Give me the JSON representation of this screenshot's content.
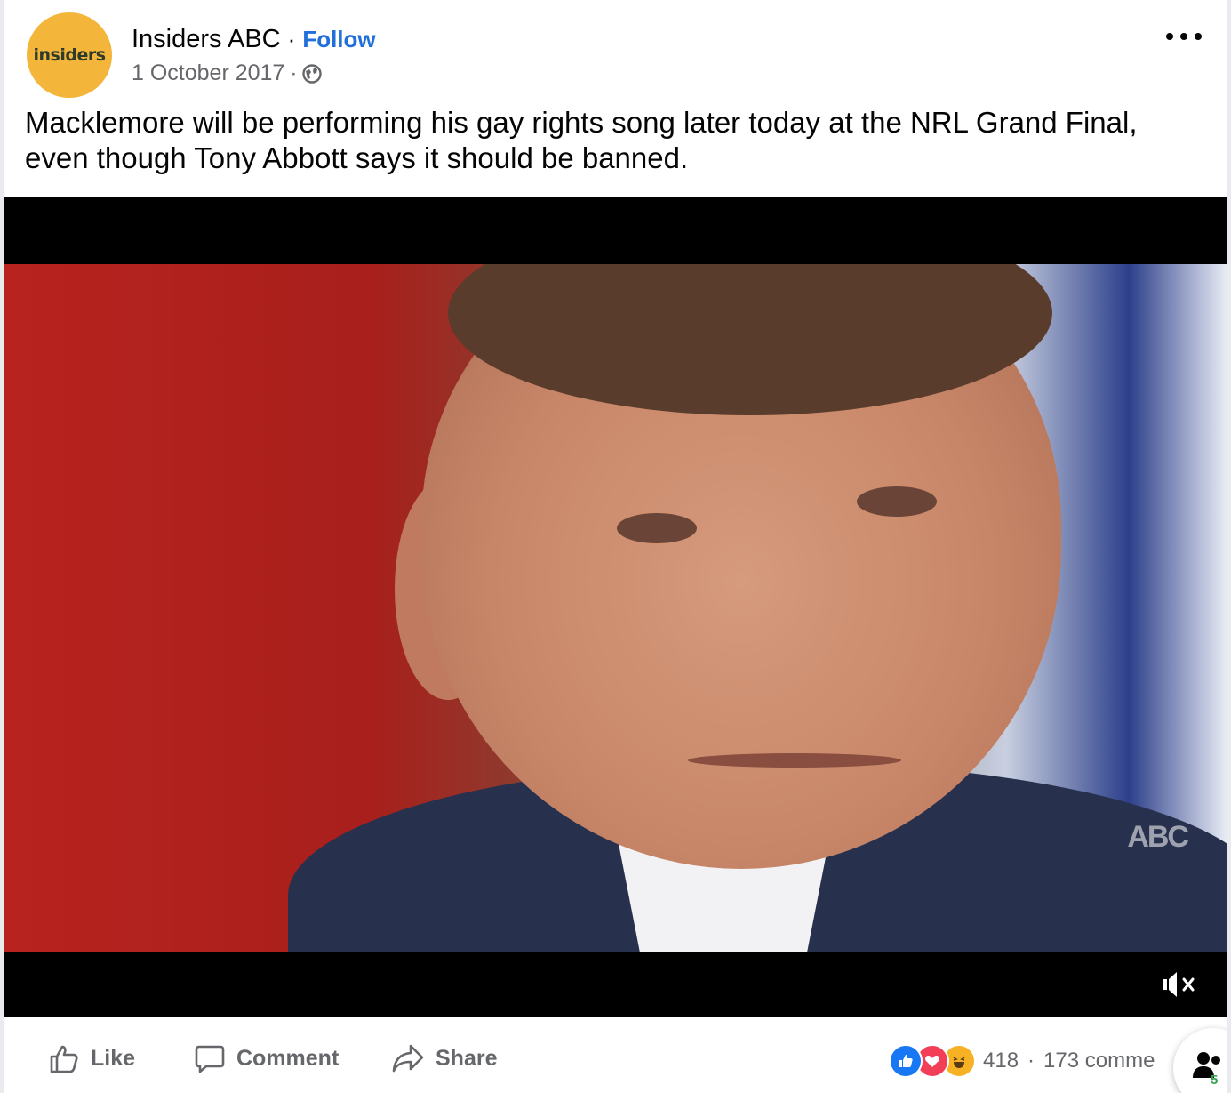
{
  "post": {
    "avatar_text": "insiders",
    "page_name": "Insiders ABC",
    "separator": "·",
    "follow_label": "Follow",
    "date": "1 October 2017",
    "date_separator": "·",
    "privacy_icon": "globe-icon",
    "text": "Macklemore will be performing his gay rights song later today at the NRL Grand Final, even though Tony Abbott says it should be banned."
  },
  "video": {
    "watermark": "ABC",
    "muted": true
  },
  "actions": {
    "like_label": "Like",
    "comment_label": "Comment",
    "share_label": "Share"
  },
  "stats": {
    "reactions": [
      "like",
      "love",
      "haha"
    ],
    "reaction_count": "418",
    "separator": "·",
    "comment_count": "173 comme"
  },
  "chat": {
    "count": "5"
  },
  "colors": {
    "link": "#216fdb",
    "avatar_bg": "#f3b63b",
    "muted_text": "#65676b"
  }
}
